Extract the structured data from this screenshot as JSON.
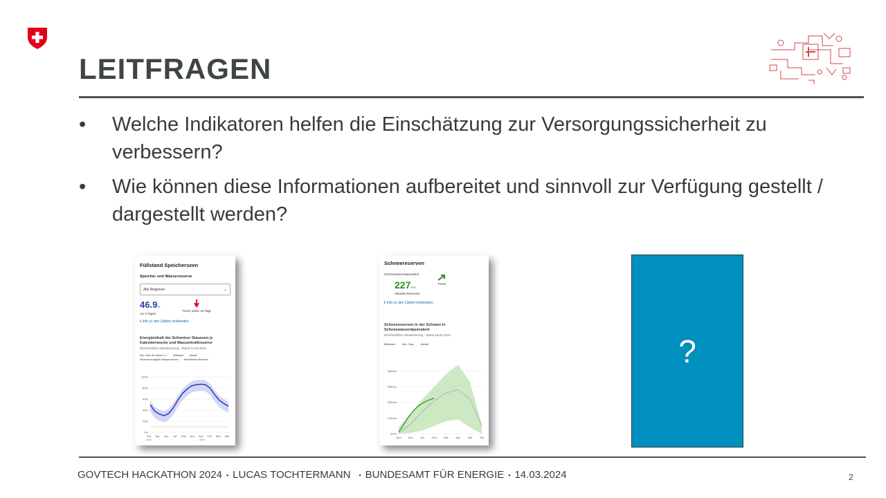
{
  "slide": {
    "title": "LEITFRAGEN",
    "bullet_symbol": "•",
    "bullets": [
      "Welche Indikatoren helfen die Einschätzung zur Versorgungssicherheit zu verbessern?",
      "Wie können diese Informationen aufbereitet und sinnvoll zur Verfügung gestellt / dargestellt werden?"
    ],
    "placeholder_text": "?",
    "page_number": "2",
    "colors": {
      "swiss_red": "#e3001b",
      "placeholder_blue": "#0090bd",
      "logo_red": "#d0464a"
    }
  },
  "footer": {
    "items": [
      "GOVTECH HACKATHON 2024",
      "LUCAS TOCHTERMANN",
      "BUNDESAMT FÜR ENERGIE",
      "14.03.2024"
    ],
    "separator": "▪"
  },
  "thumb_storage": {
    "title": "Füllstand Speicherseen",
    "subtitle": "Speicher und Wasserreserve",
    "dropdown_value": "Alle Regionen",
    "value": "46.9",
    "unit": "%",
    "value_caption": "vor 3 Tagen",
    "trend_caption": "Trend, letzte 10 Tage",
    "info_link": "Info zu den Zahlen einblenden",
    "chart_title": "Energieinhalt der Schweizer Stauseen je Kalenderwoche und Wasserkraftreserve",
    "chart_subtitle": "Wöchentliche Aktualisierung - Stand 12.02.2024",
    "legend": [
      "Min / Max der letzten 5 J.",
      "Mittelwert",
      "Aktuell",
      "Minimum zuzüglich Wasserreserve",
      "Historisches Minimum"
    ],
    "chart_data": {
      "type": "line",
      "y_ticks": [
        "100%",
        "80%",
        "60%",
        "40%",
        "20%",
        "0%"
      ],
      "x_ticks": [
        "Feb",
        "Apr",
        "Jun",
        "Jul",
        "Sep",
        "Nov",
        "Dez",
        "Feb",
        "Mar",
        "Mai"
      ],
      "x_years": [
        "2023",
        "2024"
      ],
      "ylim": [
        0,
        100
      ],
      "series": [
        {
          "name": "Aktuell",
          "color": "#1d2fb5",
          "values": [
            50,
            38,
            33,
            30,
            34,
            44,
            58,
            70,
            78,
            84,
            86,
            87,
            86,
            80,
            68,
            58,
            52,
            47
          ]
        }
      ]
    }
  },
  "thumb_snow": {
    "title": "Schneereserven",
    "kpi_label": "Schneewasseräquivalent",
    "value": "227",
    "unit": "mm",
    "value_caption": "Aktuelle Reserven",
    "trend_caption": "Trend",
    "info_link": "Info zu den Zahlen einblenden",
    "chart_title": "Schneereserven in der Schweiz in Schneewasseräquivalent",
    "chart_subtitle": "Wöchentliche Aktualisierung - Stand 15.02.2024",
    "legend": [
      "Mittelwert",
      "Min / Max",
      "Aktuell"
    ],
    "chart_data": {
      "type": "area",
      "y_ticks": [
        "400mm",
        "300mm",
        "200mm",
        "100mm",
        "0mm"
      ],
      "x_ticks": [
        "Nov",
        "Dez",
        "Jan",
        "Feb",
        "Mar",
        "Apr",
        "Mai",
        "Jun"
      ],
      "ylim": [
        0,
        450
      ],
      "series": [
        {
          "name": "Aktuell",
          "color": "#2e8b1e",
          "values": [
            10,
            60,
            110,
            150,
            180,
            200,
            215,
            227
          ]
        }
      ]
    }
  }
}
